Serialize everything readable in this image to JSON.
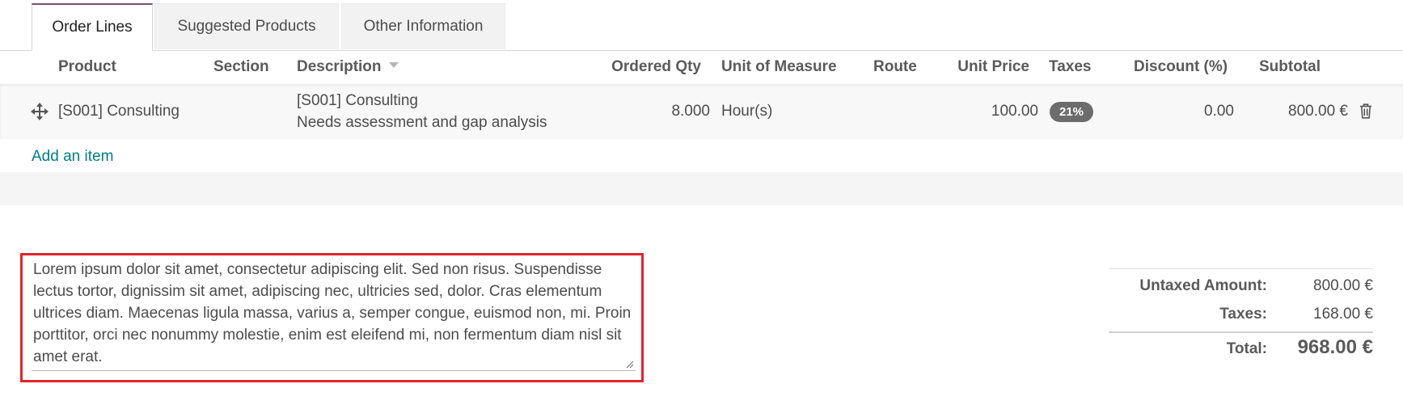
{
  "tabs": [
    {
      "label": "Order Lines"
    },
    {
      "label": "Suggested Products"
    },
    {
      "label": "Other Information"
    }
  ],
  "columns": {
    "product": "Product",
    "section": "Section",
    "description": "Description",
    "ordered_qty": "Ordered Qty",
    "uom": "Unit of Measure",
    "route": "Route",
    "unit_price": "Unit Price",
    "taxes": "Taxes",
    "discount": "Discount (%)",
    "subtotal": "Subtotal"
  },
  "line": {
    "product": "[S001] Consulting",
    "description_line1": "[S001] Consulting",
    "description_line2": "Needs assessment and gap analysis",
    "qty": "8.000",
    "uom": "Hour(s)",
    "unit_price": "100.00",
    "tax_badge": "21%",
    "discount": "0.00",
    "subtotal": "800.00 €"
  },
  "add_item": "Add an item",
  "notes": "Lorem ipsum dolor sit amet, consectetur adipiscing elit. Sed non risus. Suspendisse lectus tortor, dignissim sit amet, adipiscing nec, ultricies sed, dolor. Cras elementum ultrices diam. Maecenas ligula massa, varius a, semper congue, euismod non, mi. Proin porttitor, orci nec nonummy molestie, enim est eleifend mi, non fermentum diam nisl sit amet erat.",
  "totals": {
    "untaxed_label": "Untaxed Amount:",
    "untaxed_value": "800.00 €",
    "taxes_label": "Taxes:",
    "taxes_value": "168.00 €",
    "total_label": "Total:",
    "total_value": "968.00 €"
  },
  "icons": {
    "drag": "drag-handle-icon",
    "delete": "trash-icon",
    "sort": "sort-caret-icon"
  },
  "colors": {
    "accent": "#017e84",
    "active_tab": "#7c4f6f",
    "highlight": "#e3232b",
    "badge": "#6c6c6c"
  }
}
